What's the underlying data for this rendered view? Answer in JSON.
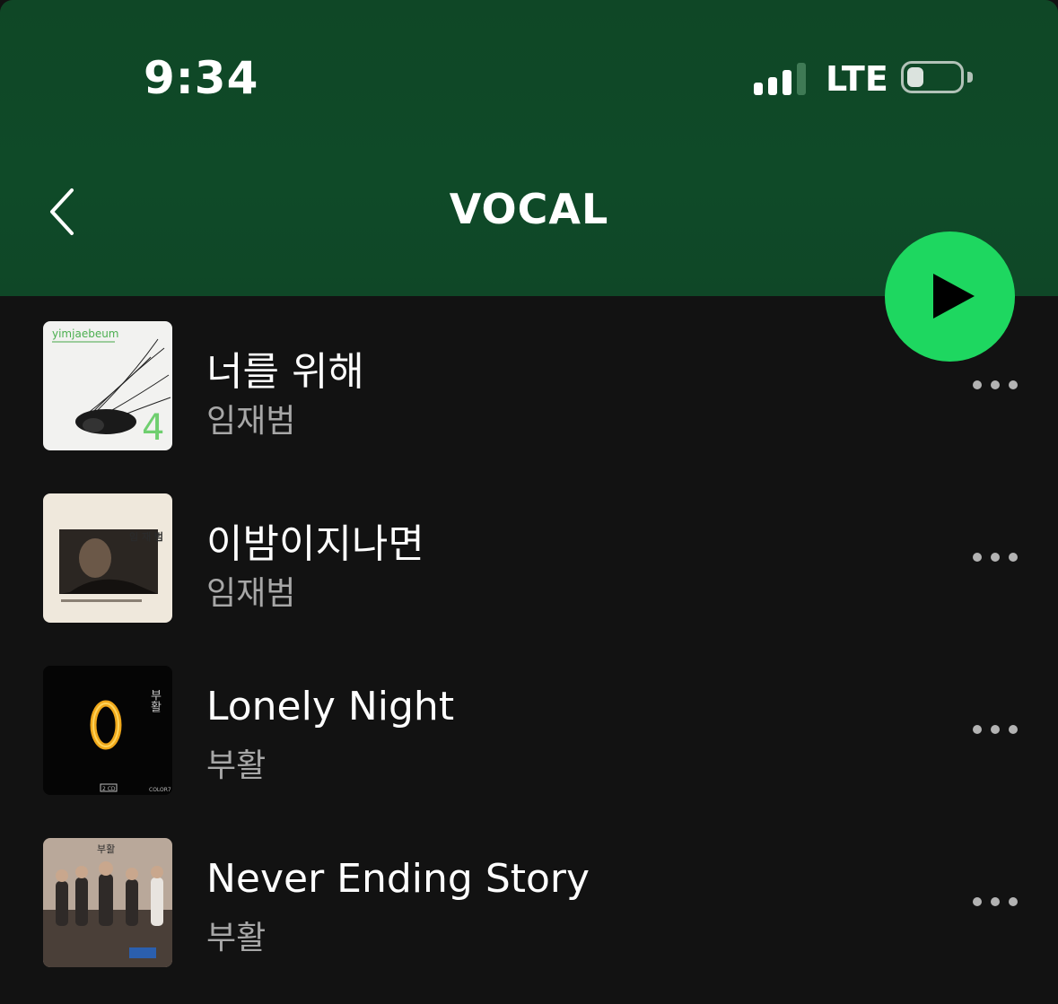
{
  "status_bar": {
    "time": "9:34",
    "network": "LTE",
    "signal_bars_active": 3,
    "signal_bars_total": 4,
    "battery_level": 0.2
  },
  "header": {
    "title": "VOCAL",
    "back_icon": "chevron-left-icon",
    "play_icon": "play-icon"
  },
  "colors": {
    "header_bg": "#0f4726",
    "accent": "#1ed760",
    "background": "#121212",
    "secondary_text": "#a7a7a7"
  },
  "tracks": [
    {
      "title": "너를 위해",
      "artist": "임재범",
      "art_text": "yimjaebeum",
      "art_label": "4"
    },
    {
      "title": "이밤이지나면",
      "artist": "임재범",
      "art_text": "임 재 범"
    },
    {
      "title": "Lonely Night",
      "artist": "부활",
      "art_text": "부활",
      "art_badge": "2 CD",
      "art_label": "COLOR7"
    },
    {
      "title": "Never Ending Story",
      "artist": "부활",
      "art_text": "부활"
    }
  ]
}
